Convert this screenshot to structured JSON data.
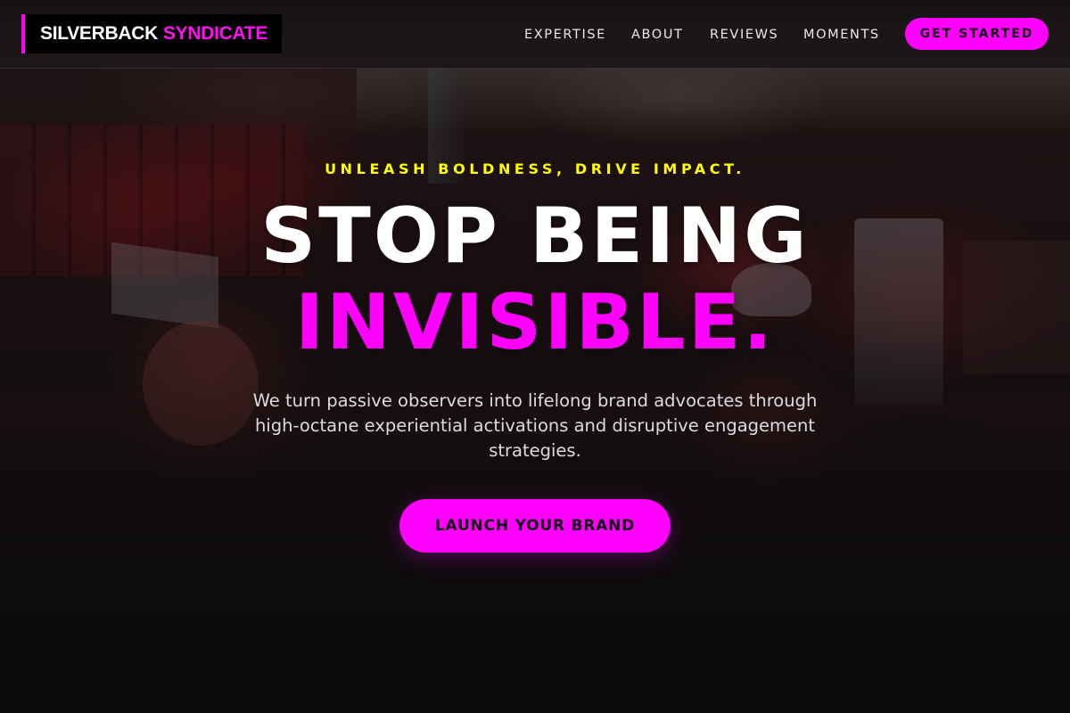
{
  "header": {
    "logo": {
      "word1": "SILVERBACK",
      "word2": "SYNDICATE"
    },
    "nav": [
      {
        "label": "EXPERTISE"
      },
      {
        "label": "ABOUT"
      },
      {
        "label": "REVIEWS"
      },
      {
        "label": "MOMENTS"
      }
    ],
    "cta_label": "GET STARTED"
  },
  "hero": {
    "eyebrow": "UNLEASH BOLDNESS, DRIVE IMPACT.",
    "headline_line1": "STOP BEING",
    "headline_line2": "INVISIBLE.",
    "subtext": "We turn passive observers into lifelong brand advocates through high-octane experiential activations and disruptive engagement strategies.",
    "cta_label": "LAUNCH YOUR BRAND"
  },
  "colors": {
    "accent": "#ff00ff",
    "eyebrow": "#ffff00",
    "background": "#0b090a",
    "text": "#ffffff"
  }
}
